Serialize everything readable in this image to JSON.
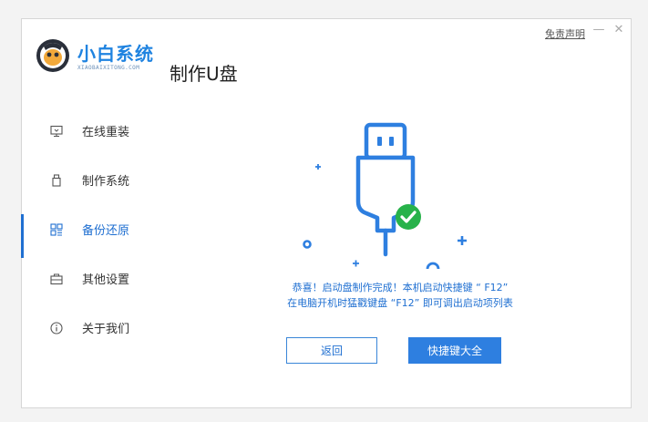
{
  "window": {
    "disclaimer": "免责声明",
    "minimize": "—",
    "close": "✕"
  },
  "brand": {
    "name": "小白系统",
    "subtitle": "XIAOBAIXITONG.COM"
  },
  "page_title": "制作U盘",
  "sidebar": {
    "items": [
      {
        "label": "在线重装",
        "icon": "monitor-icon",
        "active": false
      },
      {
        "label": "制作系统",
        "icon": "usb-drive-icon",
        "active": false
      },
      {
        "label": "备份还原",
        "icon": "grid-icon",
        "active": true
      },
      {
        "label": "其他设置",
        "icon": "toolbox-icon",
        "active": false
      },
      {
        "label": "关于我们",
        "icon": "info-icon",
        "active": false
      }
    ]
  },
  "main": {
    "message_line1": "恭喜！启动盘制作完成！本机启动快捷键 “ F12”",
    "message_line2": "在电脑开机时猛戳键盘 “F12” 即可调出启动项列表",
    "back_button": "返回",
    "shortcut_button": "快捷键大全"
  },
  "colors": {
    "accent": "#1f6fd1",
    "brand": "#1f83e0",
    "success": "#27b24a"
  }
}
